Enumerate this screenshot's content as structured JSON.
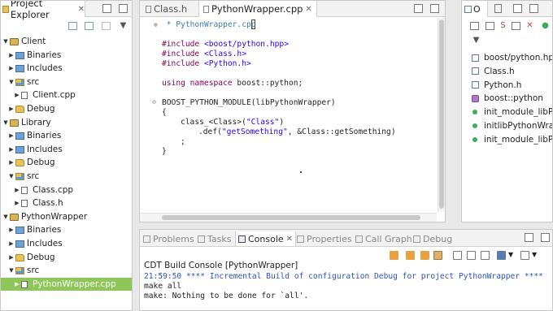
{
  "explorer": {
    "title": "Project Explorer",
    "close": "✕",
    "items": [
      {
        "label": "Client",
        "depth": 0,
        "twisty": "down",
        "icon": "project-icon"
      },
      {
        "label": "Binaries",
        "depth": 1,
        "twisty": "right",
        "icon": "binaries-icon"
      },
      {
        "label": "Includes",
        "depth": 1,
        "twisty": "right",
        "icon": "includes-icon"
      },
      {
        "label": "src",
        "depth": 1,
        "twisty": "down",
        "icon": "source-folder-icon"
      },
      {
        "label": "Client.cpp",
        "depth": 2,
        "twisty": "right",
        "icon": "cpp-file-icon"
      },
      {
        "label": "Debug",
        "depth": 1,
        "twisty": "right",
        "icon": "folder-icon"
      },
      {
        "label": "Library",
        "depth": 0,
        "twisty": "down",
        "icon": "project-icon"
      },
      {
        "label": "Binaries",
        "depth": 1,
        "twisty": "right",
        "icon": "binaries-icon"
      },
      {
        "label": "Includes",
        "depth": 1,
        "twisty": "right",
        "icon": "includes-icon"
      },
      {
        "label": "Debug",
        "depth": 1,
        "twisty": "right",
        "icon": "folder-icon"
      },
      {
        "label": "src",
        "depth": 1,
        "twisty": "down",
        "icon": "source-folder-icon"
      },
      {
        "label": "Class.cpp",
        "depth": 2,
        "twisty": "right",
        "icon": "cpp-file-icon"
      },
      {
        "label": "Class.h",
        "depth": 2,
        "twisty": "right",
        "icon": "header-file-icon"
      },
      {
        "label": "PythonWrapper",
        "depth": 0,
        "twisty": "down",
        "icon": "project-icon"
      },
      {
        "label": "Binaries",
        "depth": 1,
        "twisty": "right",
        "icon": "binaries-icon"
      },
      {
        "label": "Includes",
        "depth": 1,
        "twisty": "right",
        "icon": "includes-icon"
      },
      {
        "label": "Debug",
        "depth": 1,
        "twisty": "right",
        "icon": "folder-icon"
      },
      {
        "label": "src",
        "depth": 1,
        "twisty": "down",
        "icon": "source-folder-icon"
      },
      {
        "label": "PythonWrapper.cpp",
        "depth": 2,
        "twisty": "right",
        "icon": "cpp-file-icon",
        "selected": true
      }
    ]
  },
  "editor": {
    "tabs": [
      {
        "label": "Class.h",
        "active": false
      },
      {
        "label": "PythonWrapper.cpp",
        "active": true
      }
    ],
    "close": "✕",
    "code": {
      "comment": " * PythonWrapper.cpp",
      "include_kw": "#include",
      "includes": [
        "<boost/python.hpp>",
        "<Class.h>",
        "<Python.h>"
      ],
      "using_kw": "using namespace",
      "using_rest": " boost::python;",
      "module_line": "BOOST_PYTHON_MODULE(libPythonWrapper)",
      "open_brace": "{",
      "class_pre": "class_<Class>(",
      "class_str": "\"Class\"",
      "class_post": ")",
      "def_pre": ".def(",
      "def_str": "\"getSomething\"",
      "def_post": ", &Class::getSomething)",
      "semicolon": ";",
      "close_brace": "}"
    }
  },
  "outline": {
    "title": "O",
    "items": [
      {
        "label": "boost/python.hpp",
        "icon": "include-icon"
      },
      {
        "label": "Class.h",
        "icon": "include-icon"
      },
      {
        "label": "Python.h",
        "icon": "include-icon"
      },
      {
        "label": "boost::python",
        "icon": "namespace-icon"
      },
      {
        "label": "init_module_libPyt",
        "icon": "function-icon"
      },
      {
        "label": "initlibPythonWrapp",
        "icon": "function-icon"
      },
      {
        "label": "init_module_libPyt",
        "icon": "function-icon"
      }
    ]
  },
  "console": {
    "tabs": [
      "Problems",
      "Tasks",
      "Console",
      "Properties",
      "Call Graph",
      "Debug"
    ],
    "active_tab": "Console",
    "header": "CDT Build Console [PythonWrapper]",
    "lines": [
      "21:59:50 **** Incremental Build of configuration Debug for project PythonWrapper ****",
      "make all",
      "make: Nothing to be done for `all'."
    ],
    "colors": {
      "build_line": "#2a52c8",
      "text": "#000000"
    }
  },
  "colors": {
    "selection": "#8fc65a",
    "keyword": "#7f0055",
    "string": "#2a00ff",
    "comment": "#3f7f9f"
  }
}
